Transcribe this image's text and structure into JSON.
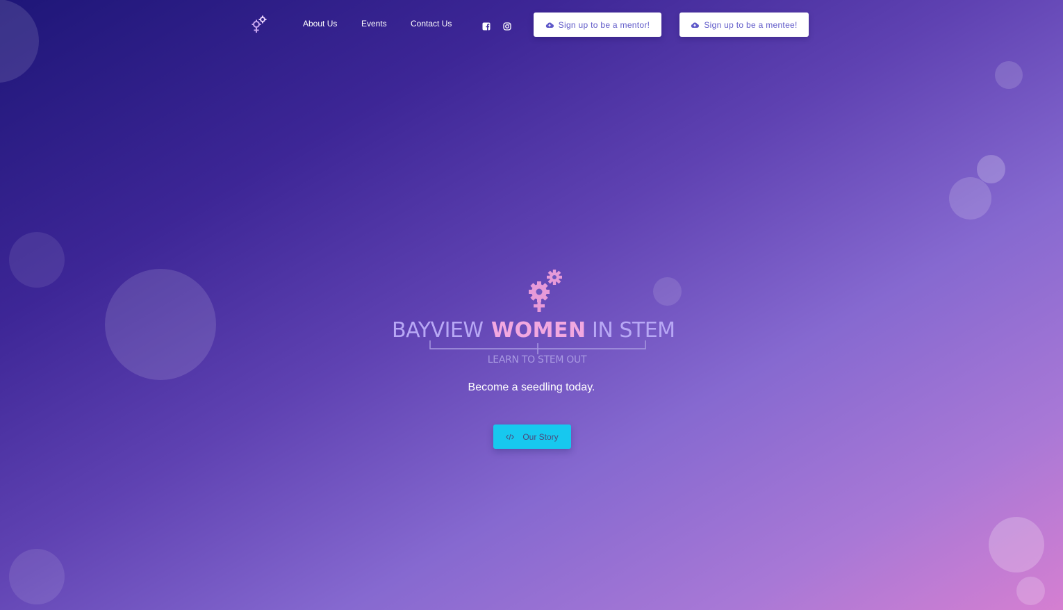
{
  "nav": {
    "links": [
      "About Us",
      "Events",
      "Contact Us"
    ],
    "social_icons": [
      "facebook-icon",
      "instagram-icon"
    ],
    "mentor_button": "Sign up to be a mentor!",
    "mentee_button": "Sign up to be a mentee!",
    "button_icon": "cloud-upload-icon"
  },
  "hero": {
    "logo_words": [
      "BAYVIEW",
      "WOMEN",
      "IN STEM"
    ],
    "tagline": "LEARN TO STEM OUT",
    "subtitle": "Become a seedling today.",
    "cta_label": "Our Story",
    "cta_icon": "code-icon"
  },
  "colors": {
    "gradient_start": "#1e1678",
    "gradient_end": "#d57fd1",
    "cta_background": "#17c8ef",
    "button_text": "#5e58c8",
    "logo_pink": "#f2a8e0",
    "logo_lavender": "#b8a8f5"
  }
}
